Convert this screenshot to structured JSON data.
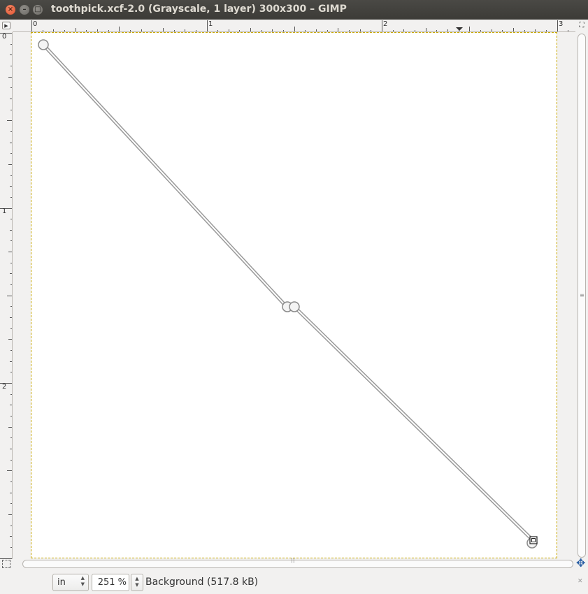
{
  "window": {
    "title": "toothpick.xcf-2.0 (Grayscale, 1 layer) 300x300 – GIMP",
    "close_glyph": "×",
    "min_glyph": "–",
    "max_glyph": "□"
  },
  "rulers": {
    "horizontal_labels": [
      "0",
      "1",
      "2",
      "3"
    ],
    "vertical_labels": [
      "0",
      "1",
      "2"
    ],
    "unit": "in"
  },
  "statusbar": {
    "unit": "in",
    "zoom": "251 %",
    "layer_info": "Background (517.8 kB)"
  },
  "icons": {
    "quick_mask": "quick-mask-icon",
    "navigate": "navigate-icon",
    "ruler_menu": "menu-arrow-icon",
    "zoom_to_window": "zoom-fit-icon"
  },
  "canvas": {
    "path_color": "#b0b0b0",
    "selection_border_color": "#c8a800"
  }
}
